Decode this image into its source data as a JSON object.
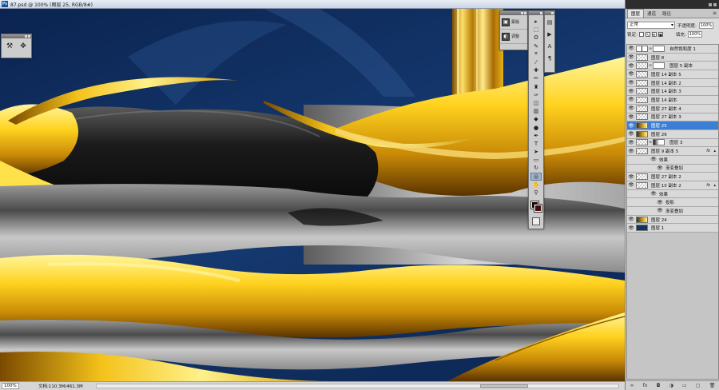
{
  "window": {
    "title": "87.psd @ 100% (图层 25, RGB/8#)"
  },
  "status": {
    "zoom": "100%",
    "doc_size": "文档:110.3M/461.3M"
  },
  "adjust_panel": {
    "items": [
      {
        "label": "蒙版",
        "icon": "mask-icon"
      },
      {
        "label": "调整",
        "icon": "adjustment-icon"
      }
    ]
  },
  "layers_panel": {
    "tabs": [
      "图层",
      "通道",
      "路径"
    ],
    "blend_mode": "正常",
    "opacity_label": "不透明度:",
    "opacity_value": "100%",
    "lock_label": "锁定:",
    "fill_label": "填充:",
    "fill_value": "100%",
    "layers": [
      {
        "name": "自然饱和度 1",
        "kind": "adjustment",
        "selected": false
      },
      {
        "name": "图层 8",
        "kind": "layer",
        "selected": false
      },
      {
        "name": "图层 5 副本",
        "kind": "masked",
        "selected": false
      },
      {
        "name": "图层 14 副本 5",
        "kind": "layer",
        "selected": false
      },
      {
        "name": "图层 14 副本 2",
        "kind": "layer",
        "selected": false
      },
      {
        "name": "图层 14 副本 3",
        "kind": "layer",
        "selected": false
      },
      {
        "name": "图层 14 副本",
        "kind": "layer",
        "selected": false
      },
      {
        "name": "图层 27 副本 4",
        "kind": "layer",
        "selected": false
      },
      {
        "name": "图层 27 副本 3",
        "kind": "layer",
        "selected": false
      },
      {
        "name": "图层 25",
        "kind": "gold",
        "selected": true
      },
      {
        "name": "图层 26",
        "kind": "gold",
        "selected": false
      },
      {
        "name": "图层 3",
        "kind": "masked",
        "selected": false
      },
      {
        "name": "图层 9 副本 5",
        "kind": "layer",
        "fx": true,
        "selected": false
      },
      {
        "name": "效果",
        "kind": "effects",
        "selected": false
      },
      {
        "name": "渐变叠加",
        "kind": "effect",
        "selected": false
      },
      {
        "name": "图层 27 副本 2",
        "kind": "layer",
        "selected": false
      },
      {
        "name": "图层 10 副本 2",
        "kind": "layer",
        "fx": true,
        "selected": false
      },
      {
        "name": "效果",
        "kind": "effects",
        "selected": false
      },
      {
        "name": "投影",
        "kind": "effect",
        "selected": false
      },
      {
        "name": "渐变叠加",
        "kind": "effect",
        "selected": false
      },
      {
        "name": "图层 24",
        "kind": "gold",
        "selected": false
      },
      {
        "name": "图层 1",
        "kind": "navy",
        "selected": false
      }
    ]
  },
  "toolbox": {
    "tools": [
      "move-tool-icon",
      "marquee-tool-icon",
      "lasso-tool-icon",
      "quick-select-tool-icon",
      "crop-tool-icon",
      "eyedropper-tool-icon",
      "healing-brush-icon",
      "brush-tool-icon",
      "clone-stamp-icon",
      "history-brush-icon",
      "eraser-tool-icon",
      "gradient-tool-icon",
      "blur-tool-icon",
      "dodge-tool-icon",
      "pen-tool-icon",
      "type-tool-icon",
      "path-select-icon",
      "shape-tool-icon",
      "3d-rotate-icon",
      "3d-orbit-icon",
      "hand-tool-icon",
      "zoom-tool-icon"
    ],
    "active_tool_index": 19,
    "foreground_color": "#100101",
    "background_color": "#4a0808"
  },
  "colors": {
    "canvas_navy": "#0e2a55",
    "gold": "#e7b314",
    "silver": "#b9b9b9",
    "selection_blue": "#3a7fd5"
  }
}
